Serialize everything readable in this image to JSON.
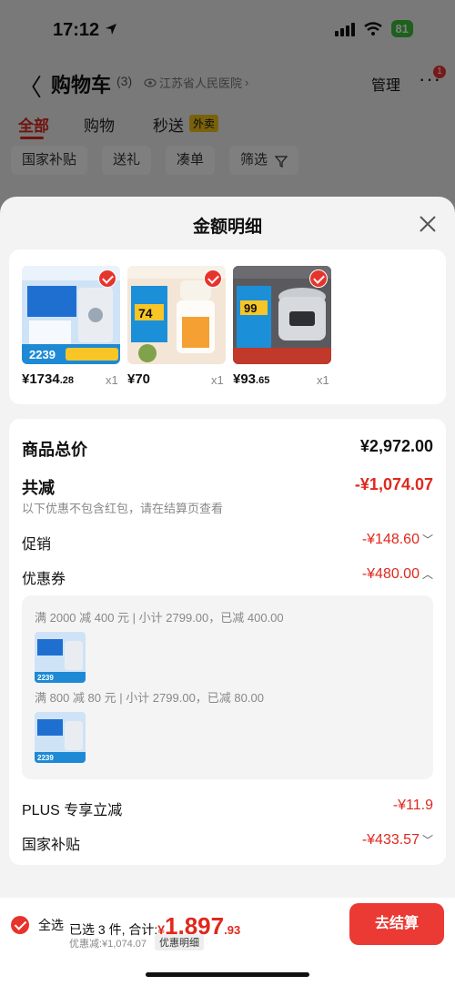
{
  "status_bar": {
    "time": "17:12",
    "battery": "81"
  },
  "cart_header": {
    "back_label": "〈",
    "title": "购物车",
    "count": "(3)",
    "location": "江苏省人民医院",
    "manage_label": "管理",
    "more_label": "···",
    "more_badge": "1"
  },
  "cart_tabs": [
    {
      "label": "全部"
    },
    {
      "label": "购物"
    },
    {
      "label": "秒送"
    }
  ],
  "cart_tab_badge": "外卖",
  "cart_filters": [
    {
      "label": "国家补贴"
    },
    {
      "label": "送礼"
    },
    {
      "label": "凑单"
    },
    {
      "label": "筛选"
    }
  ],
  "sheet": {
    "title": "金额明细",
    "products": [
      {
        "price_int": "¥1734",
        "price_dec": ".28",
        "qty": "x1",
        "img_text": "2239"
      },
      {
        "price_int": "¥70",
        "price_dec": "",
        "qty": "x1",
        "img_text": "74"
      },
      {
        "price_int": "¥93",
        "price_dec": ".65",
        "qty": "x1",
        "img_text": "99"
      }
    ],
    "rows": {
      "subtotal_label": "商品总价",
      "subtotal_value": "¥2,972.00",
      "total_discount_label": "共减",
      "total_discount_value": "-¥1,074.07",
      "note": "以下优惠不包含红包，请在结算页查看",
      "promo_label": "促销",
      "promo_value": "-¥148.60",
      "coupon_label": "优惠券",
      "coupon_value": "-¥480.00",
      "coupon_lines": [
        "满 2000 减 400 元 | 小计 2799.00，已减 400.00",
        "满 800 减 80 元 | 小计 2799.00，已减 80.00"
      ],
      "coupon_thumb_text": "2239",
      "plus_label": "PLUS 专享立减",
      "plus_value": "-¥11.9",
      "subsidy_label": "国家补贴",
      "subsidy_value": "-¥433.57"
    }
  },
  "bottom_bar": {
    "select_all": "全选",
    "selected_text": "已选 3 件, 合计:",
    "total_currency": "¥",
    "total_int": "1,897",
    "total_dec": ".93",
    "discount_note": "优惠减:¥1,074.07",
    "detail_tag": "优惠明细",
    "checkout_label": "去结算"
  },
  "colors": {
    "accent": "#e0281e",
    "checkout": "#ea3a33",
    "battery": "#3cc13b"
  }
}
